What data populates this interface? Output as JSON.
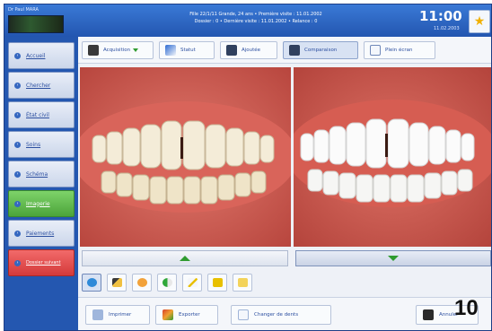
{
  "header": {
    "patient_name": "Dr Paul MARA",
    "info_line1": "Fille 22/1/11 Grande, 24 ans • Première visite : 11.01.2002",
    "info_line2": "Dossier : 0 • Dernière visite : 11.01.2002 • Relance : 0",
    "time": "11:00",
    "date": "11.02.2003"
  },
  "sidebar": {
    "items": [
      {
        "label": "Accueil",
        "style": "normal"
      },
      {
        "label": "Chercher",
        "style": "normal"
      },
      {
        "label": "État civil",
        "style": "normal"
      },
      {
        "label": "Soins",
        "style": "normal"
      },
      {
        "label": "Schéma",
        "style": "normal"
      },
      {
        "label": "Imagerie",
        "style": "green"
      },
      {
        "label": "Paiements",
        "style": "normal"
      },
      {
        "label": "Dossier suivant",
        "style": "red"
      }
    ]
  },
  "toolbar": {
    "acquisition": "Acquisition",
    "statut": "Statut",
    "ajoutee": "Ajoutée",
    "comparaison": "Comparaison",
    "plein_ecran": "Plein écran"
  },
  "bottom": {
    "imprimer": "Imprimer",
    "exporter": "Exporter",
    "changer_dents": "Changer de dents",
    "annuler": "Annuler"
  },
  "page_number": "10",
  "colors": {
    "accent": "#2b5fb8",
    "green": "#4ca43a",
    "red": "#d43a3a"
  }
}
